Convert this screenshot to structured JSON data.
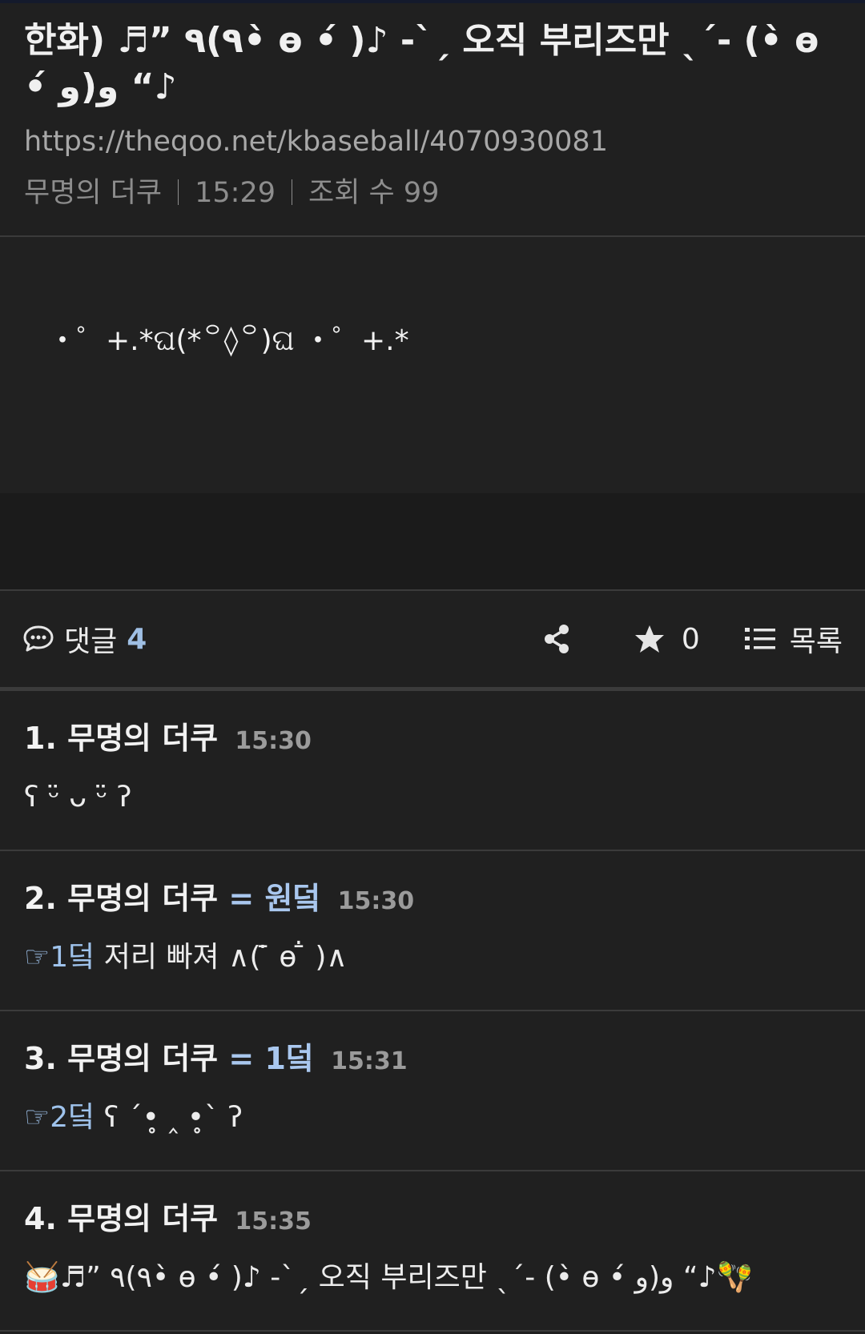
{
  "post": {
    "title": "한화) ♬” ٩(٩•̀ ɵ •́ )♪ -`ˏ 오직 부리즈만 ˎˊ- (•̀ ɵ •́ و)و “♪",
    "url": "https://theqoo.net/kbaseball/4070930081",
    "author": "무명의 더쿠",
    "time": "15:29",
    "views_label": "조회 수 99",
    "content": "・゜+.*ଘ(*꒪◊꒪)ଘ ・゜+.*"
  },
  "toolbar": {
    "comments_label": "댓글",
    "comments_count": "4",
    "star_count": "0",
    "list_label": "목록"
  },
  "comments": [
    {
      "header": "1. 무명의 더쿠",
      "badge": "",
      "time": "15:30",
      "ref": "",
      "text": "ʕ ᵕ̈ ᴗ ᵕ̈ ʔ"
    },
    {
      "header": "2. 무명의 더쿠",
      "badge": "= 원덬",
      "time": "15:30",
      "ref": "☞1덬",
      "text": " 저리 빠져 ∧( ̄̇ ɵ  ̄̇ )∧"
    },
    {
      "header": "3. 무명의 더쿠",
      "badge": "= 1덬",
      "time": "15:31",
      "ref": "☞2덬",
      "text": " ʕ ´•̥ ‸ •̥` ʔ"
    },
    {
      "header": "4. 무명의 더쿠",
      "badge": "",
      "time": "15:35",
      "ref": "",
      "text": "🥁♬” ٩(٩•̀ ɵ •́ )♪ -`ˏ 오직 부리즈만 ˎˊ- (•̀ ɵ •́ و)و “♪🪇"
    }
  ]
}
